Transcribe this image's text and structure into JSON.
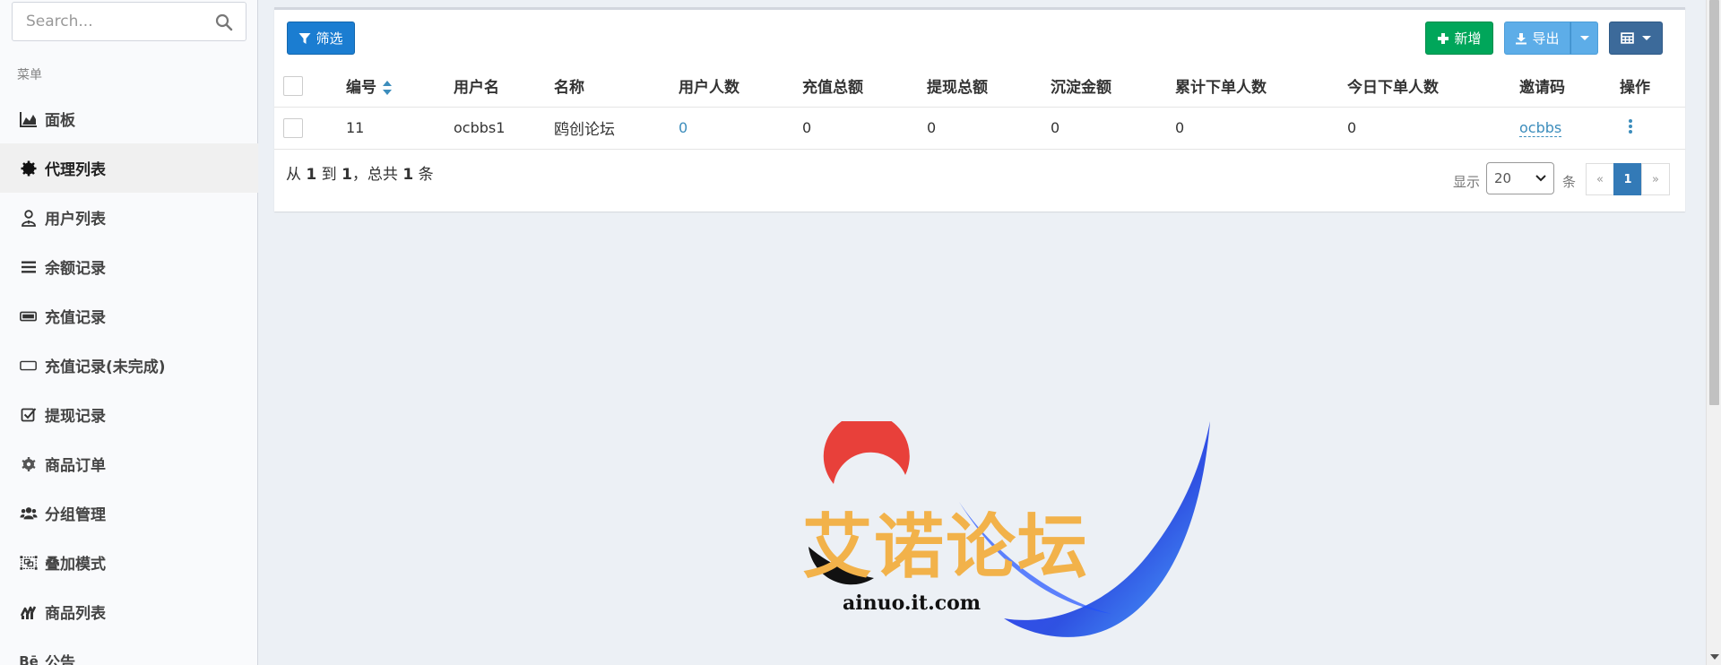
{
  "sidebar": {
    "search_placeholder": "Search...",
    "menu_header": "菜单",
    "items": [
      {
        "label": "面板",
        "icon": "area-chart-icon"
      },
      {
        "label": "代理列表",
        "icon": "gear-icon"
      },
      {
        "label": "用户列表",
        "icon": "user-tie-icon"
      },
      {
        "label": "余额记录",
        "icon": "list-icon"
      },
      {
        "label": "充值记录",
        "icon": "battery-full-icon"
      },
      {
        "label": "充值记录(未完成)",
        "icon": "battery-empty-icon"
      },
      {
        "label": "提现记录",
        "icon": "check-square-icon"
      },
      {
        "label": "商品订单",
        "icon": "cog-icon"
      },
      {
        "label": "分组管理",
        "icon": "users-icon"
      },
      {
        "label": "叠加模式",
        "icon": "object-group-icon"
      },
      {
        "label": "商品列表",
        "icon": "chart-icon"
      },
      {
        "label": "公告",
        "icon": "behance-icon"
      }
    ],
    "active_index": 1
  },
  "toolbar": {
    "filter_label": "筛选",
    "add_label": "新增",
    "export_label": "导出"
  },
  "table": {
    "columns": [
      "编号",
      "用户名",
      "名称",
      "用户人数",
      "充值总额",
      "提现总额",
      "沉淀金额",
      "累计下单人数",
      "今日下单人数",
      "邀请码",
      "操作"
    ],
    "rows": [
      {
        "id": "11",
        "username": "ocbbs1",
        "name": "鸥创论坛",
        "user_count": "0",
        "recharge_total": "0",
        "withdraw_total": "0",
        "deposit_amount": "0",
        "total_orders": "0",
        "today_orders": "0",
        "invite_code": "ocbbs"
      }
    ]
  },
  "footer": {
    "summary_from": "从",
    "summary_start": "1",
    "summary_to": "到",
    "summary_end": "1",
    "summary_total_prefix": "，总共",
    "summary_total": "1",
    "summary_unit": "条",
    "show_label": "显示",
    "page_size": "20",
    "page_size_unit": "条",
    "prev": "«",
    "current_page": "1",
    "next": "»"
  },
  "watermark": {
    "title": "艾诺论坛",
    "url": "ainuo.it.com"
  }
}
